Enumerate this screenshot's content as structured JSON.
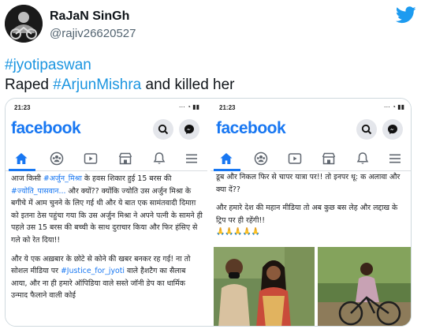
{
  "tweet": {
    "display_name": "RaJaN SinGh",
    "handle": "@rajiv26620527",
    "hashtag_line": "#jyotipaswan",
    "body_prefix": "Raped ",
    "body_mention": "#ArjunMishra",
    "body_suffix": " and killed her"
  },
  "colors": {
    "twitter_blue": "#1d9bf0",
    "facebook_blue": "#1877f2",
    "link": "#1b95e0"
  },
  "icons": [
    "twitter-bird-icon",
    "search-icon",
    "messenger-icon",
    "home-icon",
    "groups-icon",
    "watch-icon",
    "marketplace-icon",
    "bell-icon",
    "menu-icon"
  ],
  "left_screenshot": {
    "time": "21:23",
    "status_icons": "⋯ ◔ ▮▮",
    "brand": "facebook",
    "paragraph1_a": "आज किसी ",
    "paragraph1_link1": "#अर्जुन_मिश्रा",
    "paragraph1_b": " के हवस शिकार हुई 15 बरस की ",
    "paragraph1_link2": "#ज्योति_पासवान...",
    "paragraph1_c": " और क्यों?? क्योंकि ज्योति उस अर्जुन मिश्रा के बगीचे में आम चुनने के लिए गई थी और ये बात एक सामंतवादी दिमाग़ को इतना ठेस पहुंचा गया कि उस अर्जुन मिश्रा ने अपने पत्नी के सामने ही पहले उस 15 बरस की बच्ची के साथ दुराचार किया और फिर हंसिए से गले को रेत दिया!!",
    "paragraph2_a": "और ये एक अख़बार के छोटे से कोने की खबर बनकर रह गई! ना तो सोशल मीडिया पर ",
    "paragraph2_link": "#Justice_for_jyoti",
    "paragraph2_b": " वाले हैशटैग का सैलाब आया, और ना ही हमारे ऑपिडिया वाले सस्ते जॉनी डेप का धार्मिक उन्माद फैलाने वाली कोई"
  },
  "right_screenshot": {
    "time": "21:23",
    "status_icons": "⋯ ◔ ▮▮",
    "brand": "facebook",
    "paragraph1": "डूब और निकल फिर से चापर यात्रा पर!! तो इनपर थू: क अलावा और क्या दें??",
    "paragraph2": "और हमारे देश की महान मीडिया तो अब कुछ बस लेह और लद्दाख के ट्रिप पर ही रहेंगी!!",
    "emojis": "🙏🙏🙏🙏🙏"
  }
}
